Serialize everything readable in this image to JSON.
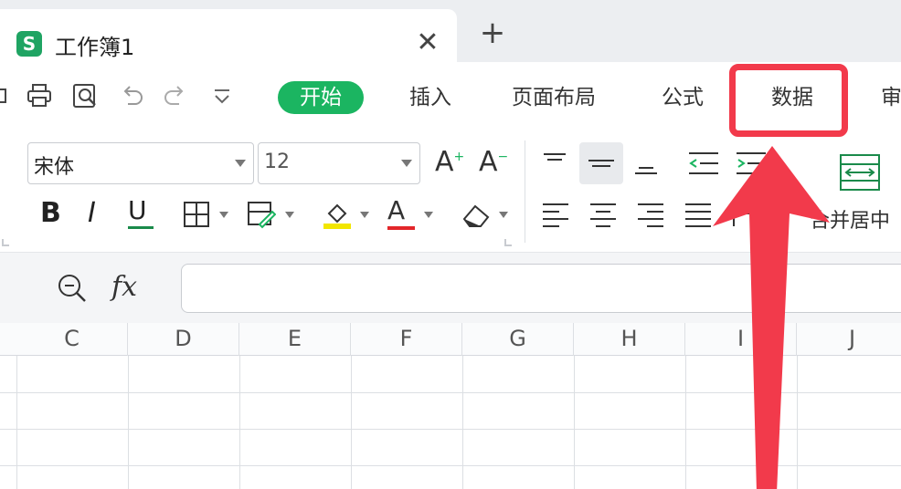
{
  "tab": {
    "icon": "S",
    "title": "工作簿1",
    "close": "✕",
    "add": "+"
  },
  "quick_access": [
    "print-icon",
    "print-preview-icon",
    "undo-icon",
    "redo-icon",
    "customize-dropdown-icon"
  ],
  "menu": {
    "tabs": [
      {
        "label": "开始",
        "active": true
      },
      {
        "label": "插入"
      },
      {
        "label": "页面布局"
      },
      {
        "label": "公式"
      },
      {
        "label": "数据"
      },
      {
        "label": "审"
      }
    ]
  },
  "toolbar": {
    "font_name": "宋体",
    "font_size": "12",
    "bold": "B",
    "italic": "I",
    "underline": "U",
    "font_grow": "A",
    "font_shrink": "A",
    "font_color": "A",
    "merge_label": "合并居中"
  },
  "formula_bar": {
    "fx_label": "fx",
    "value": ""
  },
  "grid": {
    "columns": [
      "C",
      "D",
      "E",
      "F",
      "G",
      "H",
      "I",
      "J"
    ]
  },
  "colors": {
    "active_tab": "#1bb561",
    "highlight": "#f23a4b",
    "app_icon": "#1fa463",
    "highlight_fill_color": "#f2e600",
    "font_color_bar": "#e3262a"
  }
}
